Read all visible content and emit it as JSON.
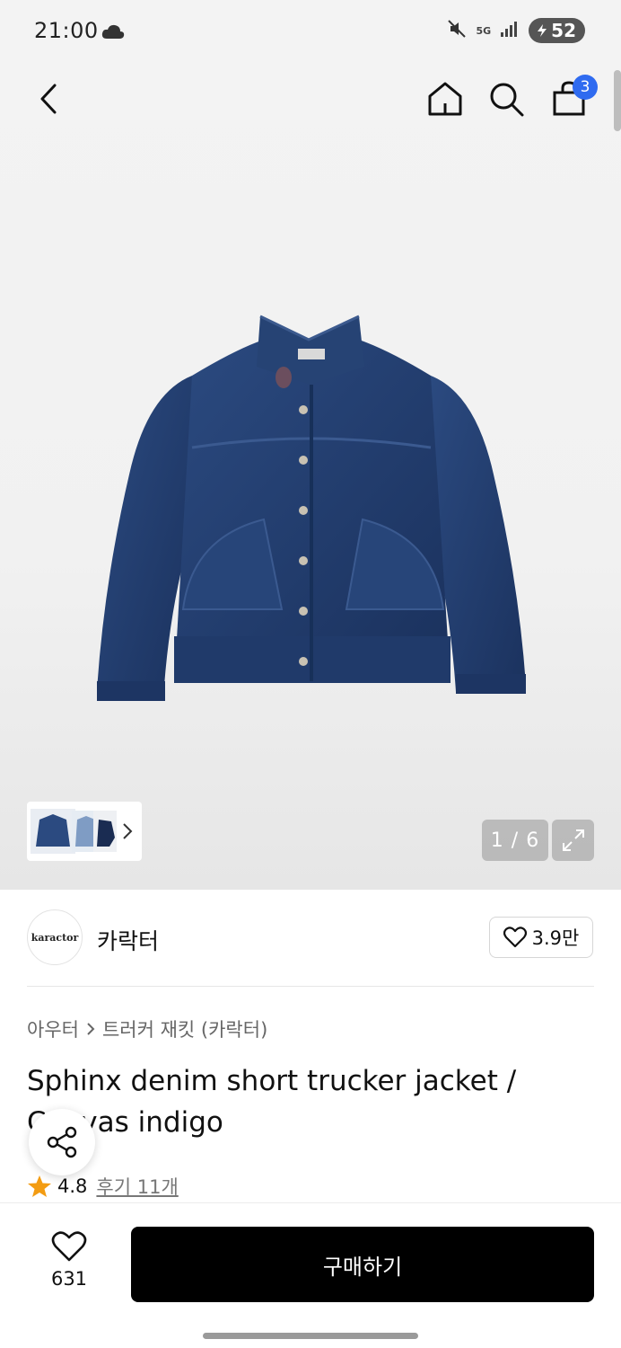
{
  "status_bar": {
    "time": "21:00",
    "network": "5G",
    "battery": "52"
  },
  "nav": {
    "cart_count": "3"
  },
  "gallery": {
    "counter": "1 / 6"
  },
  "brand": {
    "logo_text": "karactor",
    "name": "카락터",
    "likes": "3.9만"
  },
  "breadcrumb": {
    "category": "아우터",
    "subcategory": "트러커 재킷 (카락터)"
  },
  "product": {
    "title": "Sphinx denim short trucker jacket / Canvas indigo"
  },
  "rating": {
    "score": "4.8",
    "reviews": "후기 11개"
  },
  "bottom_bar": {
    "wish_count": "631",
    "buy_label": "구매하기"
  },
  "colors": {
    "accent_badge": "#2f6bf0",
    "buy_button": "#000000",
    "star": "#f39c12",
    "denim": "#1f3a6b"
  },
  "icons": [
    "back-icon",
    "home-icon",
    "search-icon",
    "bag-icon",
    "expand-icon",
    "heart-icon",
    "share-icon",
    "star-icon",
    "chevron-right-icon"
  ]
}
